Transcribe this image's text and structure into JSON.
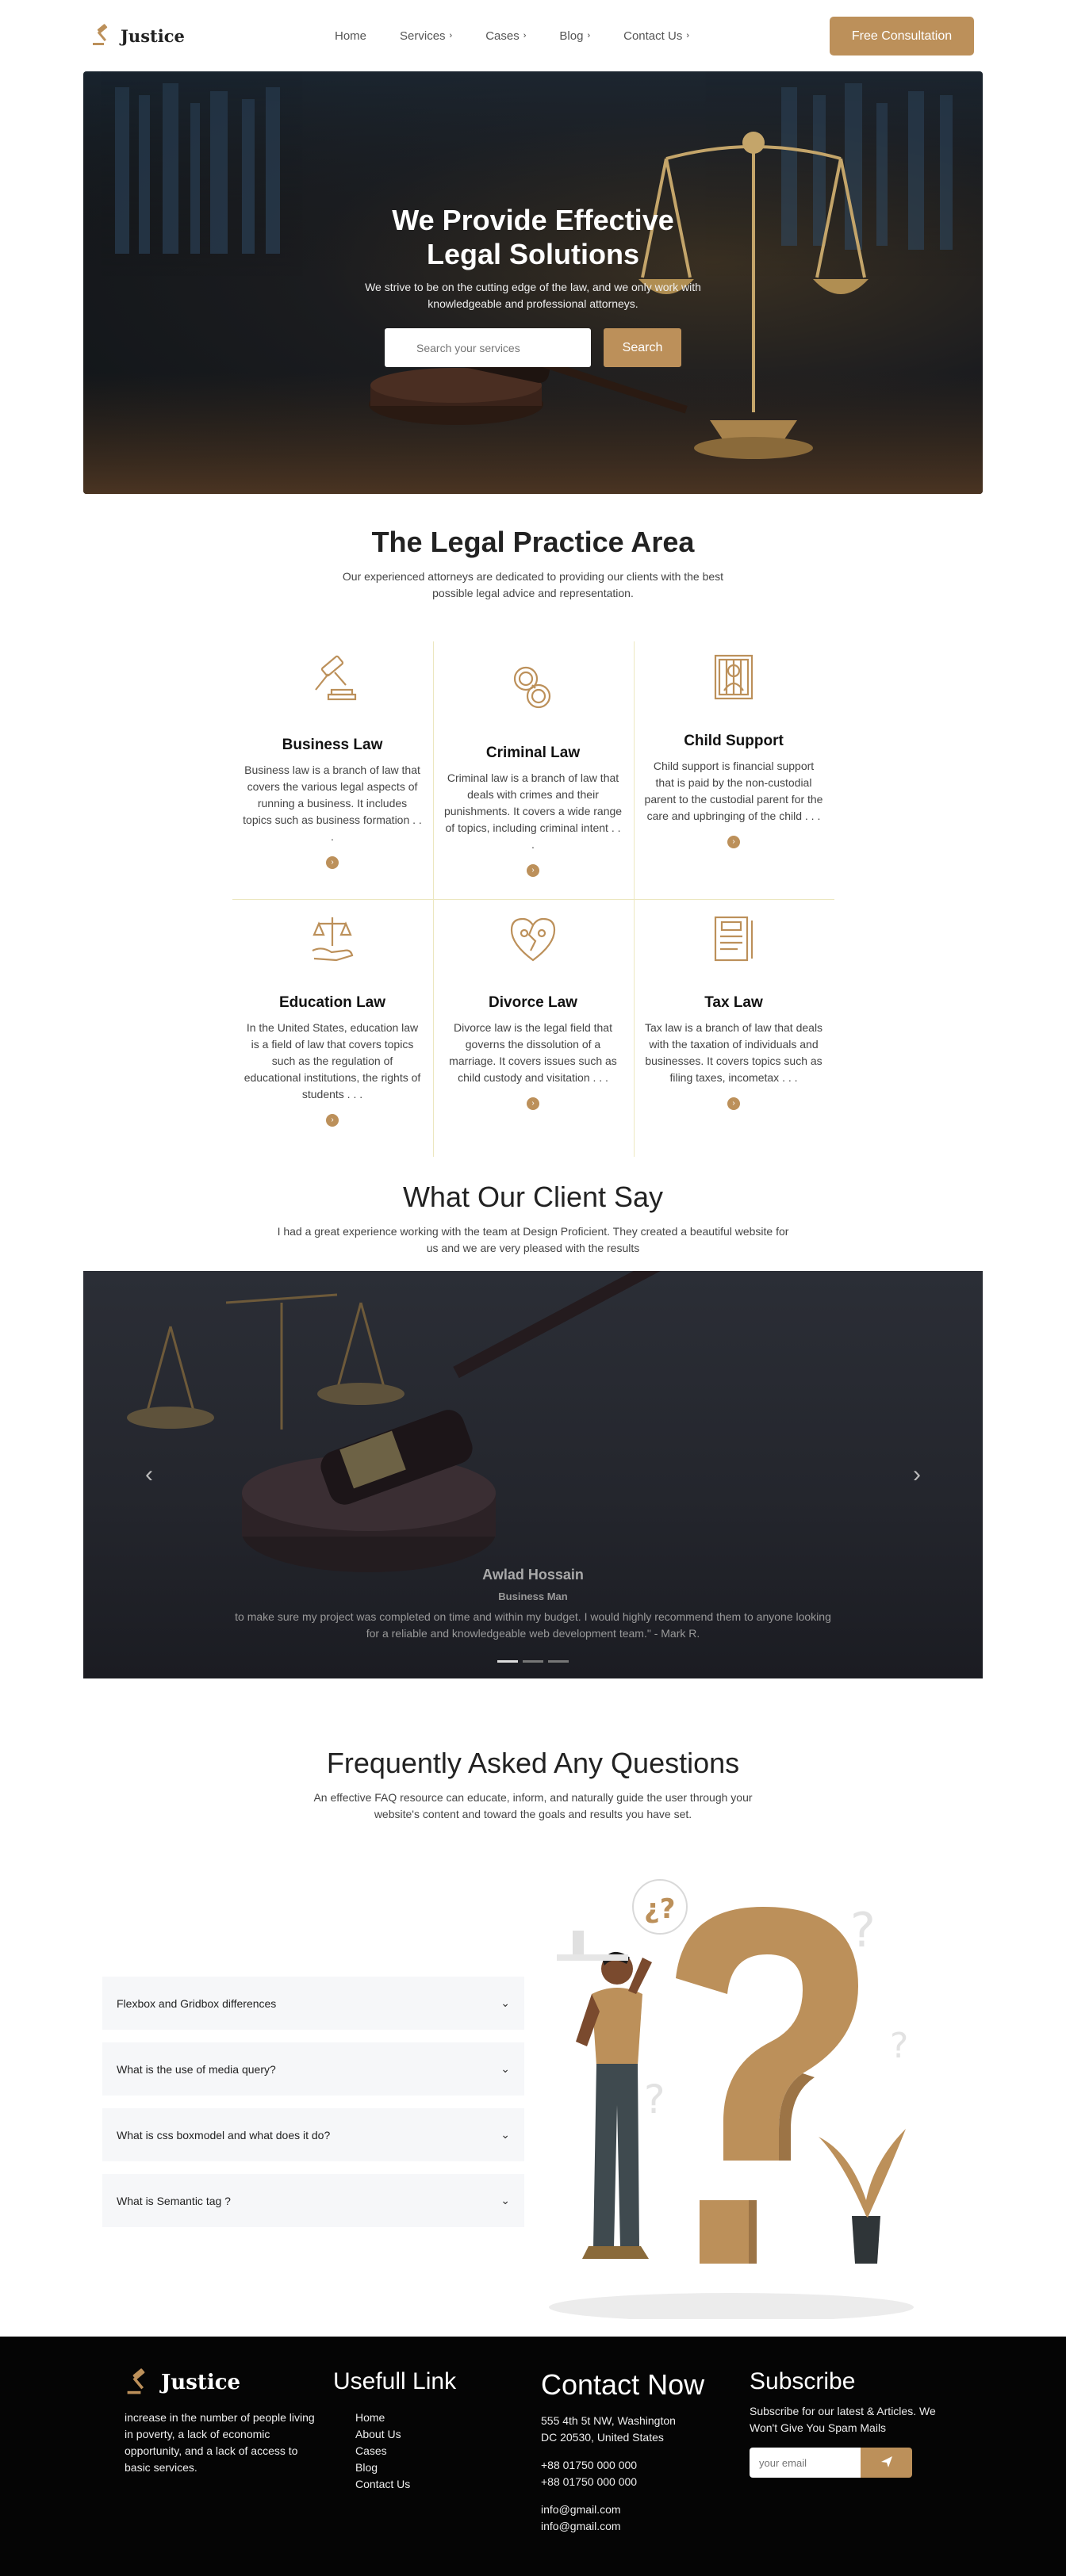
{
  "nav": {
    "brand": "Justice",
    "links": [
      {
        "label": "Home",
        "chevron": ""
      },
      {
        "label": "Services",
        "chevron": "›"
      },
      {
        "label": "Cases",
        "chevron": "›"
      },
      {
        "label": "Blog",
        "chevron": "›"
      },
      {
        "label": "Contact Us",
        "chevron": "›"
      }
    ],
    "cta": "Free Consultation"
  },
  "hero": {
    "title": "We Provide Effective Legal Solutions",
    "subtitle": "We strive to be on the cutting edge of the law, and we only work with knowledgeable and professional attorneys.",
    "search_placeholder": "Search your services",
    "search_button": "Search"
  },
  "practice": {
    "title": "The Legal Practice Area",
    "subtitle": "Our experienced attorneys are dedicated to providing our clients with the best possible legal advice and representation.",
    "items": [
      {
        "icon": "gavel-icon",
        "title": "Business Law",
        "text": "Business law is a branch of law that covers the various legal aspects of running a business. It includes topics such as business formation . . ."
      },
      {
        "icon": "handcuffs-icon",
        "title": "Criminal Law",
        "text": "Criminal law is a branch of law that deals with crimes and their punishments. It covers a wide range of topics, including criminal intent . . ."
      },
      {
        "icon": "prisoner-icon",
        "title": "Child Support",
        "text": "Child support is financial support that is paid by the non-custodial parent to the custodial parent for the care and upbringing of the child . . ."
      },
      {
        "icon": "scales-hand-icon",
        "title": "Education Law",
        "text": "In the United States, education law is a field of law that covers topics such as the regulation of educational institutions, the rights of students . . ."
      },
      {
        "icon": "broken-heart-icon",
        "title": "Divorce Law",
        "text": "Divorce law is the legal field that governs the dissolution of a marriage. It covers issues such as child custody and visitation . . ."
      },
      {
        "icon": "tax-document-icon",
        "title": "Tax Law",
        "text": "Tax law is a branch of law that deals with the taxation of individuals and businesses. It covers topics such as filing taxes, incometax . . ."
      }
    ],
    "arrow": "›"
  },
  "testimonials": {
    "title": "What Our Client Say",
    "subtitle": "I had a great experience working with the team at Design Proficient. They created a beautiful website for us and we are very pleased with the results",
    "name": "Awlad Hossain",
    "role": "Business Man",
    "quote": "to make sure my project was completed on time and within my budget. I would highly recommend them to anyone looking for a reliable and knowledgeable web development team.\" - Mark R.",
    "prev": "‹",
    "next": "›",
    "slide_count": 3,
    "active_slide": 0
  },
  "faq": {
    "title": "Frequently Asked Any Questions",
    "subtitle": "An effective FAQ resource can educate, inform, and naturally guide the user through your website's content and toward the goals and results you have set.",
    "items": [
      {
        "q": "Flexbox and Gridbox differences"
      },
      {
        "q": "What is the use of media query?"
      },
      {
        "q": "What is css boxmodel and what does it do?"
      },
      {
        "q": "What is Semantic tag ?"
      }
    ],
    "caret": "⌄"
  },
  "footer": {
    "brand": "Justice",
    "desc": "increase in the number of people living in poverty, a lack of economic opportunity, and a lack of access to basic services.",
    "links_title": "Usefull Link",
    "links": [
      "Home",
      "About Us",
      "Cases",
      "Blog",
      "Contact Us"
    ],
    "contact_title": "Contact Now",
    "address1": "555 4th 5t NW, Washington",
    "address2": "DC 20530, United States",
    "phone1": "+88 01750 000 000",
    "phone2": "+88 01750 000 000",
    "email1": "info@gmail.com",
    "email2": "info@gmail.com",
    "subscribe_title": "Subscribe",
    "subscribe_text": "Subscribe for our latest & Articles. We Won't Give You Spam Mails",
    "email_placeholder": "your email"
  },
  "colors": {
    "accent": "#bc905a",
    "footer_bg": "#050505"
  }
}
